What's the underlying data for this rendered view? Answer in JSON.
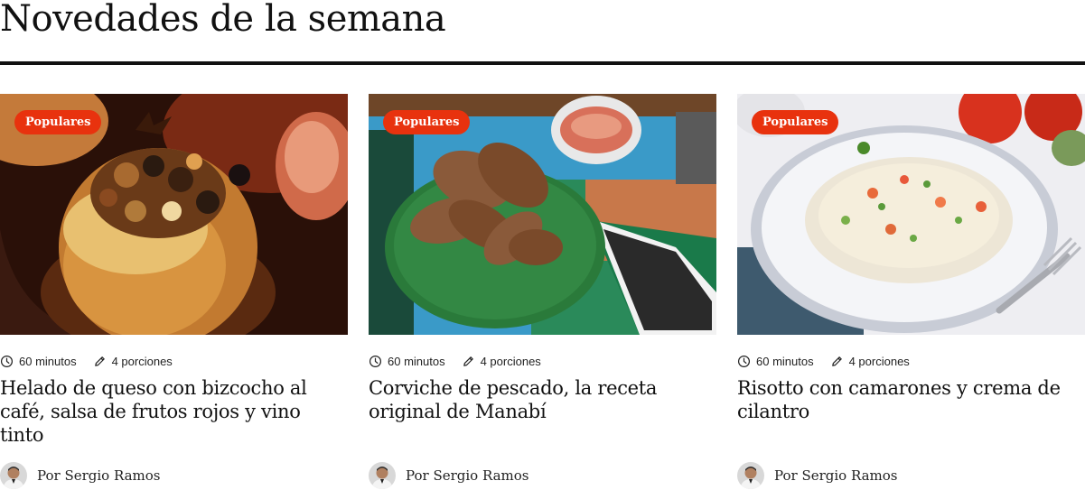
{
  "section": {
    "title": "Novedades de la semana"
  },
  "cards": [
    {
      "badge": "Populares",
      "time": "60 minutos",
      "portions": "4 porciones",
      "title": "Helado de queso con bizcocho al café, salsa de frutos rojos y vino tinto",
      "author": "Por Sergio Ramos"
    },
    {
      "badge": "Populares",
      "time": "60 minutos",
      "portions": "4 porciones",
      "title": "Corviche de pescado, la receta original de Manabí",
      "author": "Por Sergio Ramos"
    },
    {
      "badge": "Populares",
      "time": "60 minutos",
      "portions": "4 porciones",
      "title": "Risotto con camarones y crema de cilantro",
      "author": "Por Sergio Ramos"
    }
  ],
  "icons": {
    "time": "clock-icon",
    "portions": "pencil-icon"
  },
  "colors": {
    "badge": "#e8320e",
    "rule": "#111111"
  }
}
